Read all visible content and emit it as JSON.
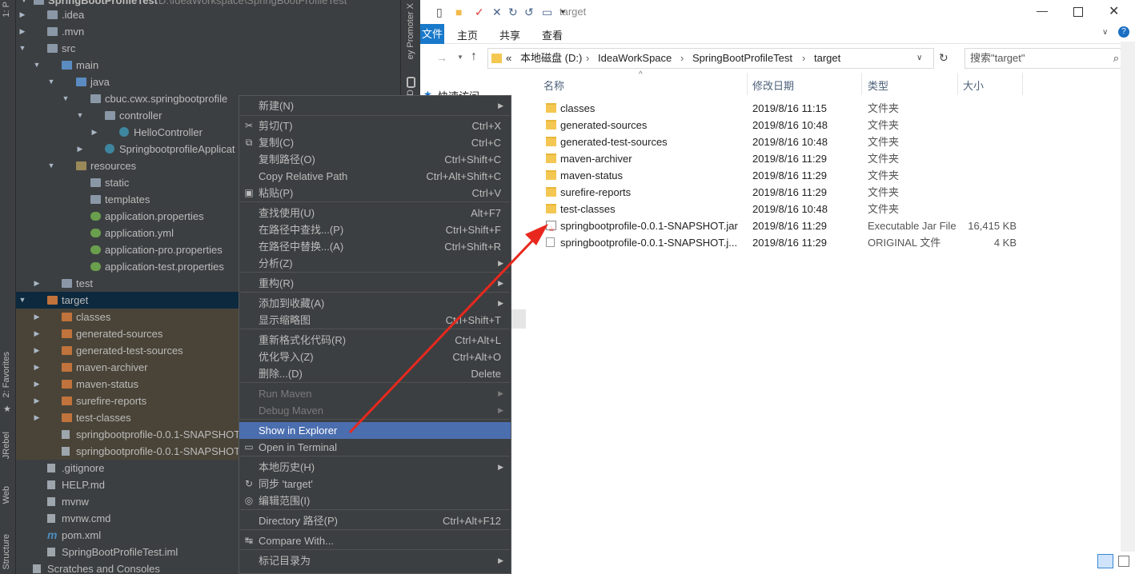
{
  "ide": {
    "left_tabs": {
      "project": "1: P",
      "favorites": "2: Favorites",
      "jrebel": "JRebel",
      "web": "Web",
      "structure": "Structure"
    },
    "right_tabs": {
      "promoter": "ey Promoter X",
      "db": "D"
    },
    "root_label": "SpringBootProfileTest",
    "root_path": "D:\\IdeaWorkspace\\SpringBootProfileTest",
    "tree": [
      {
        "label": ".idea"
      },
      {
        "label": ".mvn"
      },
      {
        "label": "src"
      },
      {
        "label": "main"
      },
      {
        "label": "java"
      },
      {
        "label": "cbuc.cwx.springbootprofile"
      },
      {
        "label": "controller"
      },
      {
        "label": "HelloController"
      },
      {
        "label": "SpringbootprofileApplicat"
      },
      {
        "label": "resources"
      },
      {
        "label": "static"
      },
      {
        "label": "templates"
      },
      {
        "label": "application.properties"
      },
      {
        "label": "application.yml"
      },
      {
        "label": "application-pro.properties"
      },
      {
        "label": "application-test.properties"
      },
      {
        "label": "test"
      },
      {
        "label": "target"
      },
      {
        "label": "classes"
      },
      {
        "label": "generated-sources"
      },
      {
        "label": "generated-test-sources"
      },
      {
        "label": "maven-archiver"
      },
      {
        "label": "maven-status"
      },
      {
        "label": "surefire-reports"
      },
      {
        "label": "test-classes"
      },
      {
        "label": "springbootprofile-0.0.1-SNAPSHOT"
      },
      {
        "label": "springbootprofile-0.0.1-SNAPSHOT"
      },
      {
        "label": ".gitignore"
      },
      {
        "label": "HELP.md"
      },
      {
        "label": "mvnw"
      },
      {
        "label": "mvnw.cmd"
      },
      {
        "label": "pom.xml"
      },
      {
        "label": "SpringBootProfileTest.iml"
      },
      {
        "label": "Scratches and Consoles"
      }
    ]
  },
  "context_menu": {
    "items": [
      {
        "label": "新建(N)",
        "shortcut": ""
      },
      {
        "label": "剪切(T)",
        "shortcut": "Ctrl+X"
      },
      {
        "label": "复制(C)",
        "shortcut": "Ctrl+C"
      },
      {
        "label": "复制路径(O)",
        "shortcut": "Ctrl+Shift+C"
      },
      {
        "label": "Copy Relative Path",
        "shortcut": "Ctrl+Alt+Shift+C"
      },
      {
        "label": "粘贴(P)",
        "shortcut": "Ctrl+V"
      },
      {
        "label": "查找使用(U)",
        "shortcut": "Alt+F7"
      },
      {
        "label": "在路径中查找...(P)",
        "shortcut": "Ctrl+Shift+F"
      },
      {
        "label": "在路径中替换...(A)",
        "shortcut": "Ctrl+Shift+R"
      },
      {
        "label": "分析(Z)",
        "shortcut": ""
      },
      {
        "label": "重构(R)",
        "shortcut": ""
      },
      {
        "label": "添加到收藏(A)",
        "shortcut": ""
      },
      {
        "label": "显示缩略图",
        "shortcut": "Ctrl+Shift+T"
      },
      {
        "label": "重新格式化代码(R)",
        "shortcut": "Ctrl+Alt+L"
      },
      {
        "label": "优化导入(Z)",
        "shortcut": "Ctrl+Alt+O"
      },
      {
        "label": "删除...(D)",
        "shortcut": "Delete"
      },
      {
        "label": "Run Maven",
        "shortcut": ""
      },
      {
        "label": "Debug Maven",
        "shortcut": ""
      },
      {
        "label": "Show in Explorer",
        "shortcut": ""
      },
      {
        "label": "Open in Terminal",
        "shortcut": ""
      },
      {
        "label": "本地历史(H)",
        "shortcut": ""
      },
      {
        "label": "同步 'target'",
        "shortcut": ""
      },
      {
        "label": "编辑范围(I)",
        "shortcut": ""
      },
      {
        "label": "Directory 路径(P)",
        "shortcut": "Ctrl+Alt+F12"
      },
      {
        "label": "Compare With...",
        "shortcut": ""
      },
      {
        "label": "标记目录为",
        "shortcut": ""
      }
    ]
  },
  "explorer": {
    "title": "target",
    "ribbon_tabs": {
      "file": "文件",
      "home": "主页",
      "share": "共享",
      "view": "查看"
    },
    "breadcrumb": [
      "«",
      "本地磁盘 (D:)",
      "IdeaWorkSpace",
      "SpringBootProfileTest",
      "target"
    ],
    "search_placeholder": "搜索\"target\"",
    "nav_quick_access": "快速访问",
    "columns": {
      "name": "名称",
      "date": "修改日期",
      "type": "类型",
      "size": "大小"
    },
    "files": [
      {
        "name": "classes",
        "date": "2019/8/16 11:15",
        "type": "文件夹",
        "size": "",
        "kind": "dir"
      },
      {
        "name": "generated-sources",
        "date": "2019/8/16 10:48",
        "type": "文件夹",
        "size": "",
        "kind": "dir"
      },
      {
        "name": "generated-test-sources",
        "date": "2019/8/16 10:48",
        "type": "文件夹",
        "size": "",
        "kind": "dir"
      },
      {
        "name": "maven-archiver",
        "date": "2019/8/16 11:29",
        "type": "文件夹",
        "size": "",
        "kind": "dir"
      },
      {
        "name": "maven-status",
        "date": "2019/8/16 11:29",
        "type": "文件夹",
        "size": "",
        "kind": "dir"
      },
      {
        "name": "surefire-reports",
        "date": "2019/8/16 11:29",
        "type": "文件夹",
        "size": "",
        "kind": "dir"
      },
      {
        "name": "test-classes",
        "date": "2019/8/16 10:48",
        "type": "文件夹",
        "size": "",
        "kind": "dir"
      },
      {
        "name": "springbootprofile-0.0.1-SNAPSHOT.jar",
        "date": "2019/8/16 11:29",
        "type": "Executable Jar File",
        "size": "16,415 KB",
        "kind": "jar"
      },
      {
        "name": "springbootprofile-0.0.1-SNAPSHOT.j...",
        "date": "2019/8/16 11:29",
        "type": "ORIGINAL 文件",
        "size": "4 KB",
        "kind": "doc"
      }
    ]
  },
  "annotation": {
    "arrow_color": "#e8281e"
  }
}
